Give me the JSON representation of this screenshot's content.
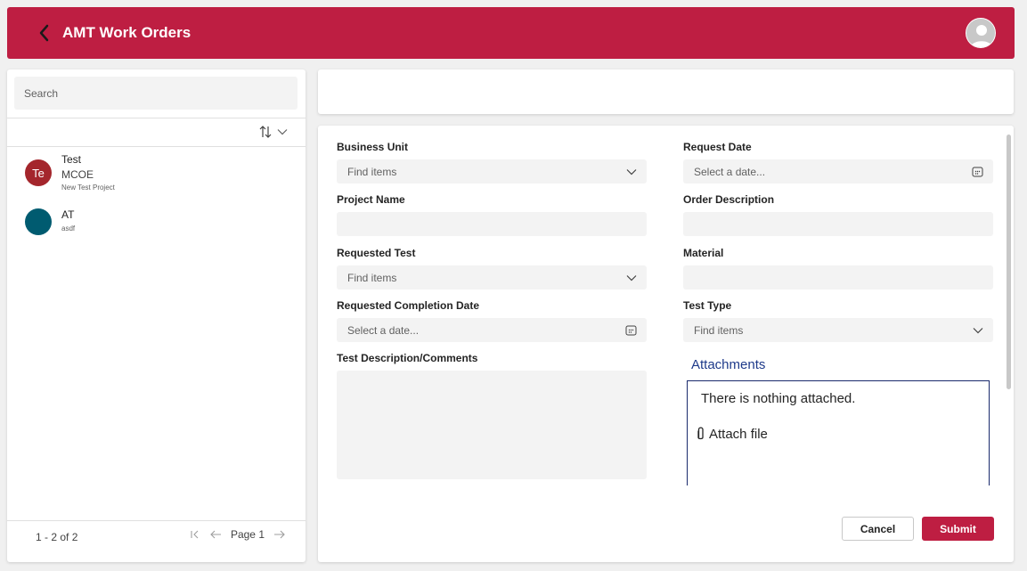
{
  "header": {
    "title": "AMT Work Orders",
    "back_icon": "chevron-left-icon",
    "avatar_icon": "user-avatar-icon",
    "color": "#be1e42"
  },
  "sidebar": {
    "search_placeholder": "Search",
    "sort_icon": "sort-icon",
    "items": [
      {
        "initials": "Te",
        "title": "Test",
        "subtitle": "MCOE",
        "detail": "New Test Project",
        "avatar_color": "#a4262c"
      },
      {
        "initials": "",
        "title": "AT",
        "subtitle": "",
        "detail": "asdf",
        "avatar_color": "#005b70"
      }
    ],
    "pager": {
      "count": "1 - 2 of 2",
      "page_label": "Page 1"
    }
  },
  "form": {
    "business_unit": {
      "label": "Business Unit",
      "placeholder": "Find items"
    },
    "request_date": {
      "label": "Request Date",
      "placeholder": "Select a date..."
    },
    "project_name": {
      "label": "Project Name",
      "value": ""
    },
    "order_description": {
      "label": "Order Description",
      "value": ""
    },
    "requested_test": {
      "label": "Requested Test",
      "placeholder": "Find items"
    },
    "material": {
      "label": "Material",
      "value": ""
    },
    "requested_completion_date": {
      "label": "Requested Completion Date",
      "placeholder": "Select a date..."
    },
    "test_type": {
      "label": "Test Type",
      "placeholder": "Find items"
    },
    "test_description": {
      "label": "Test Description/Comments",
      "value": ""
    },
    "attachments": {
      "title": "Attachments",
      "empty_text": "There is nothing attached.",
      "attach_label": "Attach file"
    },
    "buttons": {
      "cancel": "Cancel",
      "submit": "Submit"
    }
  }
}
